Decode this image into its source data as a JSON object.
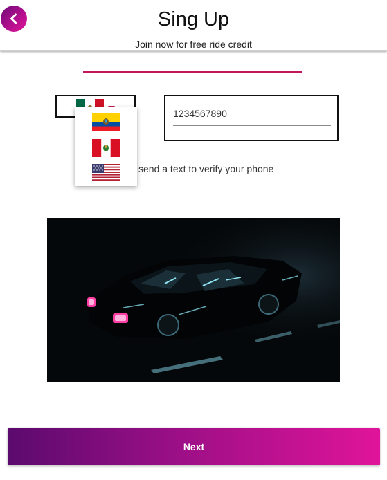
{
  "header": {
    "title": "Sing Up",
    "subtitle": "Join now for free ride credit",
    "back_icon": "chevron-left-icon"
  },
  "progress": {
    "value": 0.5,
    "color": "#c2185b"
  },
  "country_select": {
    "selected": "Mexico",
    "options": [
      "Ecuador",
      "Peru",
      "United States"
    ]
  },
  "phone": {
    "value": "1234567890"
  },
  "hint_text": "send a text to verify your phone",
  "illustration": "dark-car-image",
  "next_button": {
    "label": "Next"
  },
  "colors": {
    "accent": "#c2185b",
    "button_start": "#5b0a6e",
    "button_end": "#e0149a"
  }
}
